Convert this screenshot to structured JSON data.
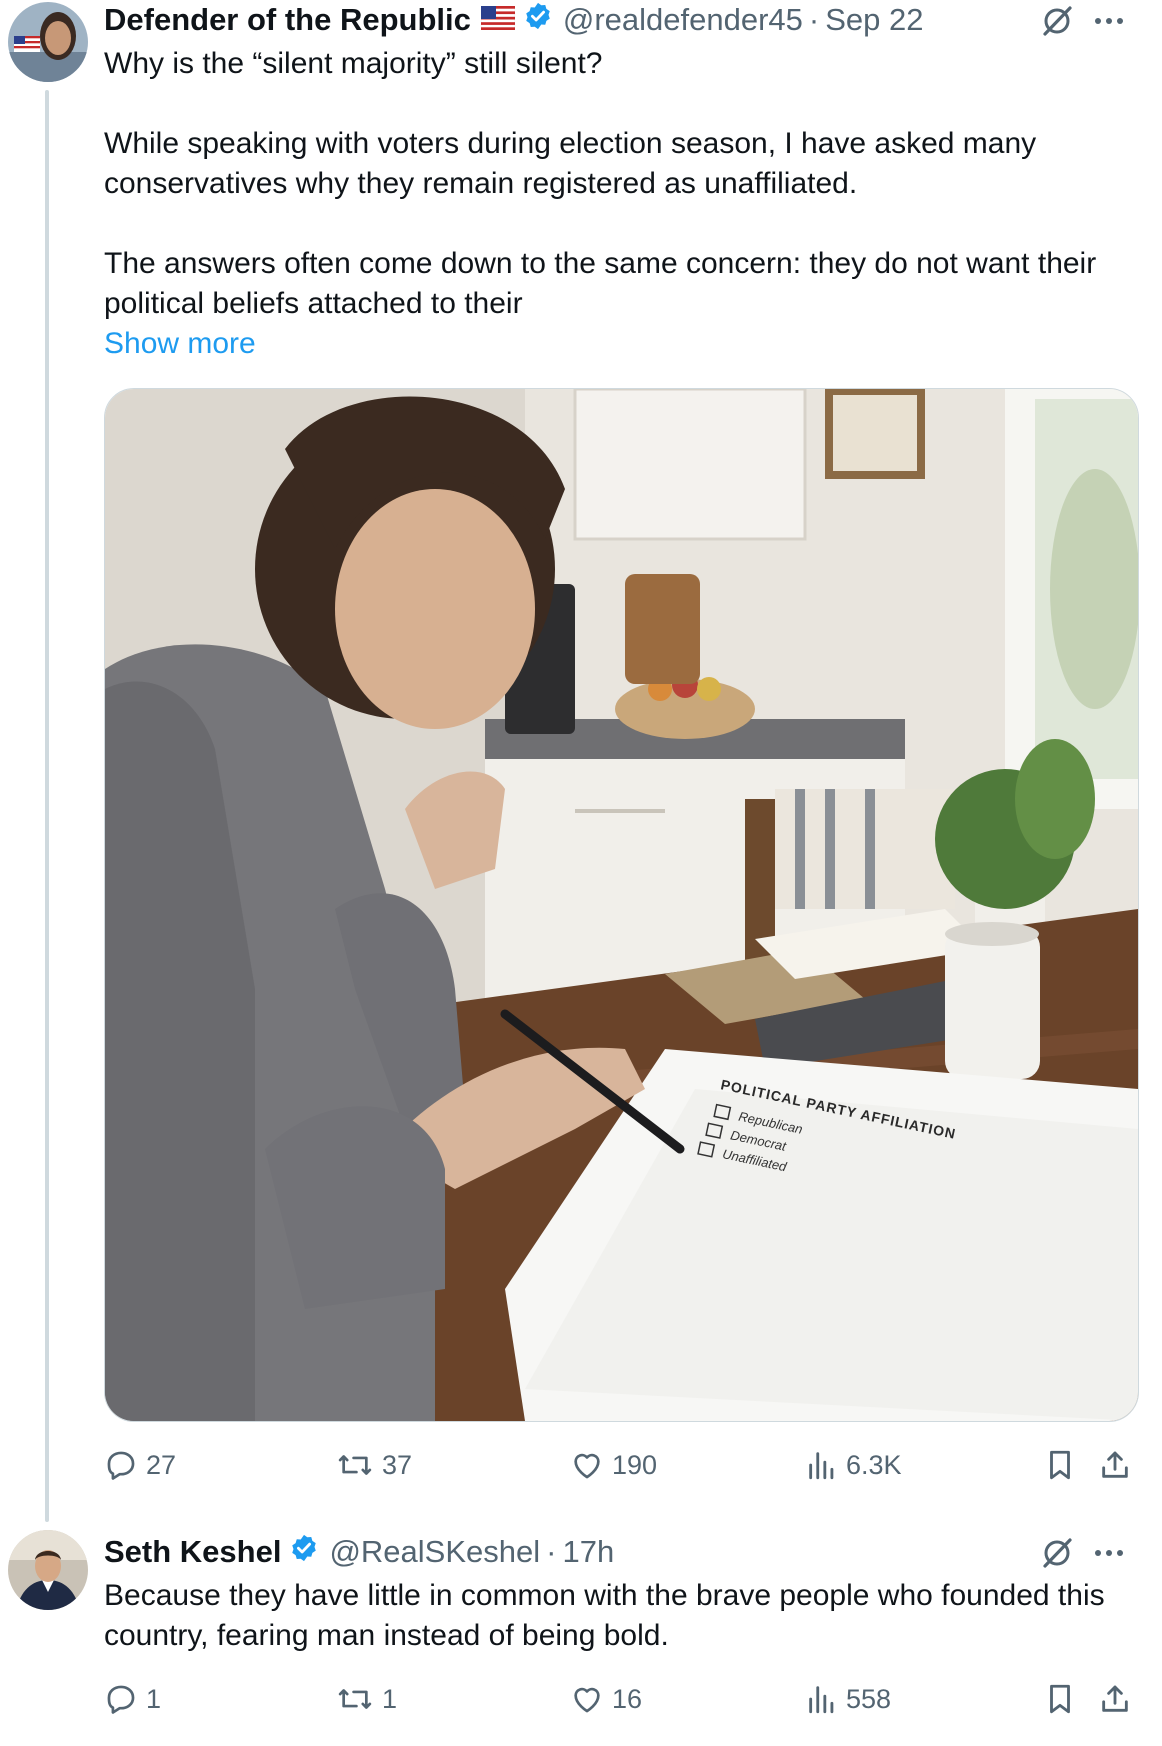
{
  "tweet": {
    "author_name": "Defender of the Republic",
    "handle": "@realdefender45",
    "time": "Sep 22",
    "headline": "Why is the “silent majority” still silent?",
    "paragraph1": "While speaking with voters during election season, I have asked many conservatives why they remain registered as unaffiliated.",
    "paragraph2": "The answers often come down to the same concern: they do not want their political beliefs attached to their",
    "show_more": "Show more",
    "form": {
      "title": "POLITICAL PARTY AFFILIATION",
      "options": [
        "Republican",
        "Democrat",
        "Unaffiliated"
      ]
    },
    "stats": {
      "replies": "27",
      "reposts": "37",
      "likes": "190",
      "views": "6.3K"
    }
  },
  "reply": {
    "author_name": "Seth Keshel",
    "handle": "@RealSKeshel",
    "time": "17h",
    "text": "Because they have little in common with the brave people who founded this country, fearing man instead of being bold.",
    "stats": {
      "replies": "1",
      "reposts": "1",
      "likes": "16",
      "views": "558"
    }
  },
  "colors": {
    "accent": "#1d9bf0",
    "muted": "#536471",
    "text": "#0f1419",
    "verified": "#1d9bf0"
  },
  "icons": [
    "grok-icon",
    "more-icon",
    "reply-icon",
    "repost-icon",
    "like-icon",
    "views-icon",
    "bookmark-icon",
    "share-icon",
    "verified-badge-icon",
    "us-flag-icon"
  ]
}
